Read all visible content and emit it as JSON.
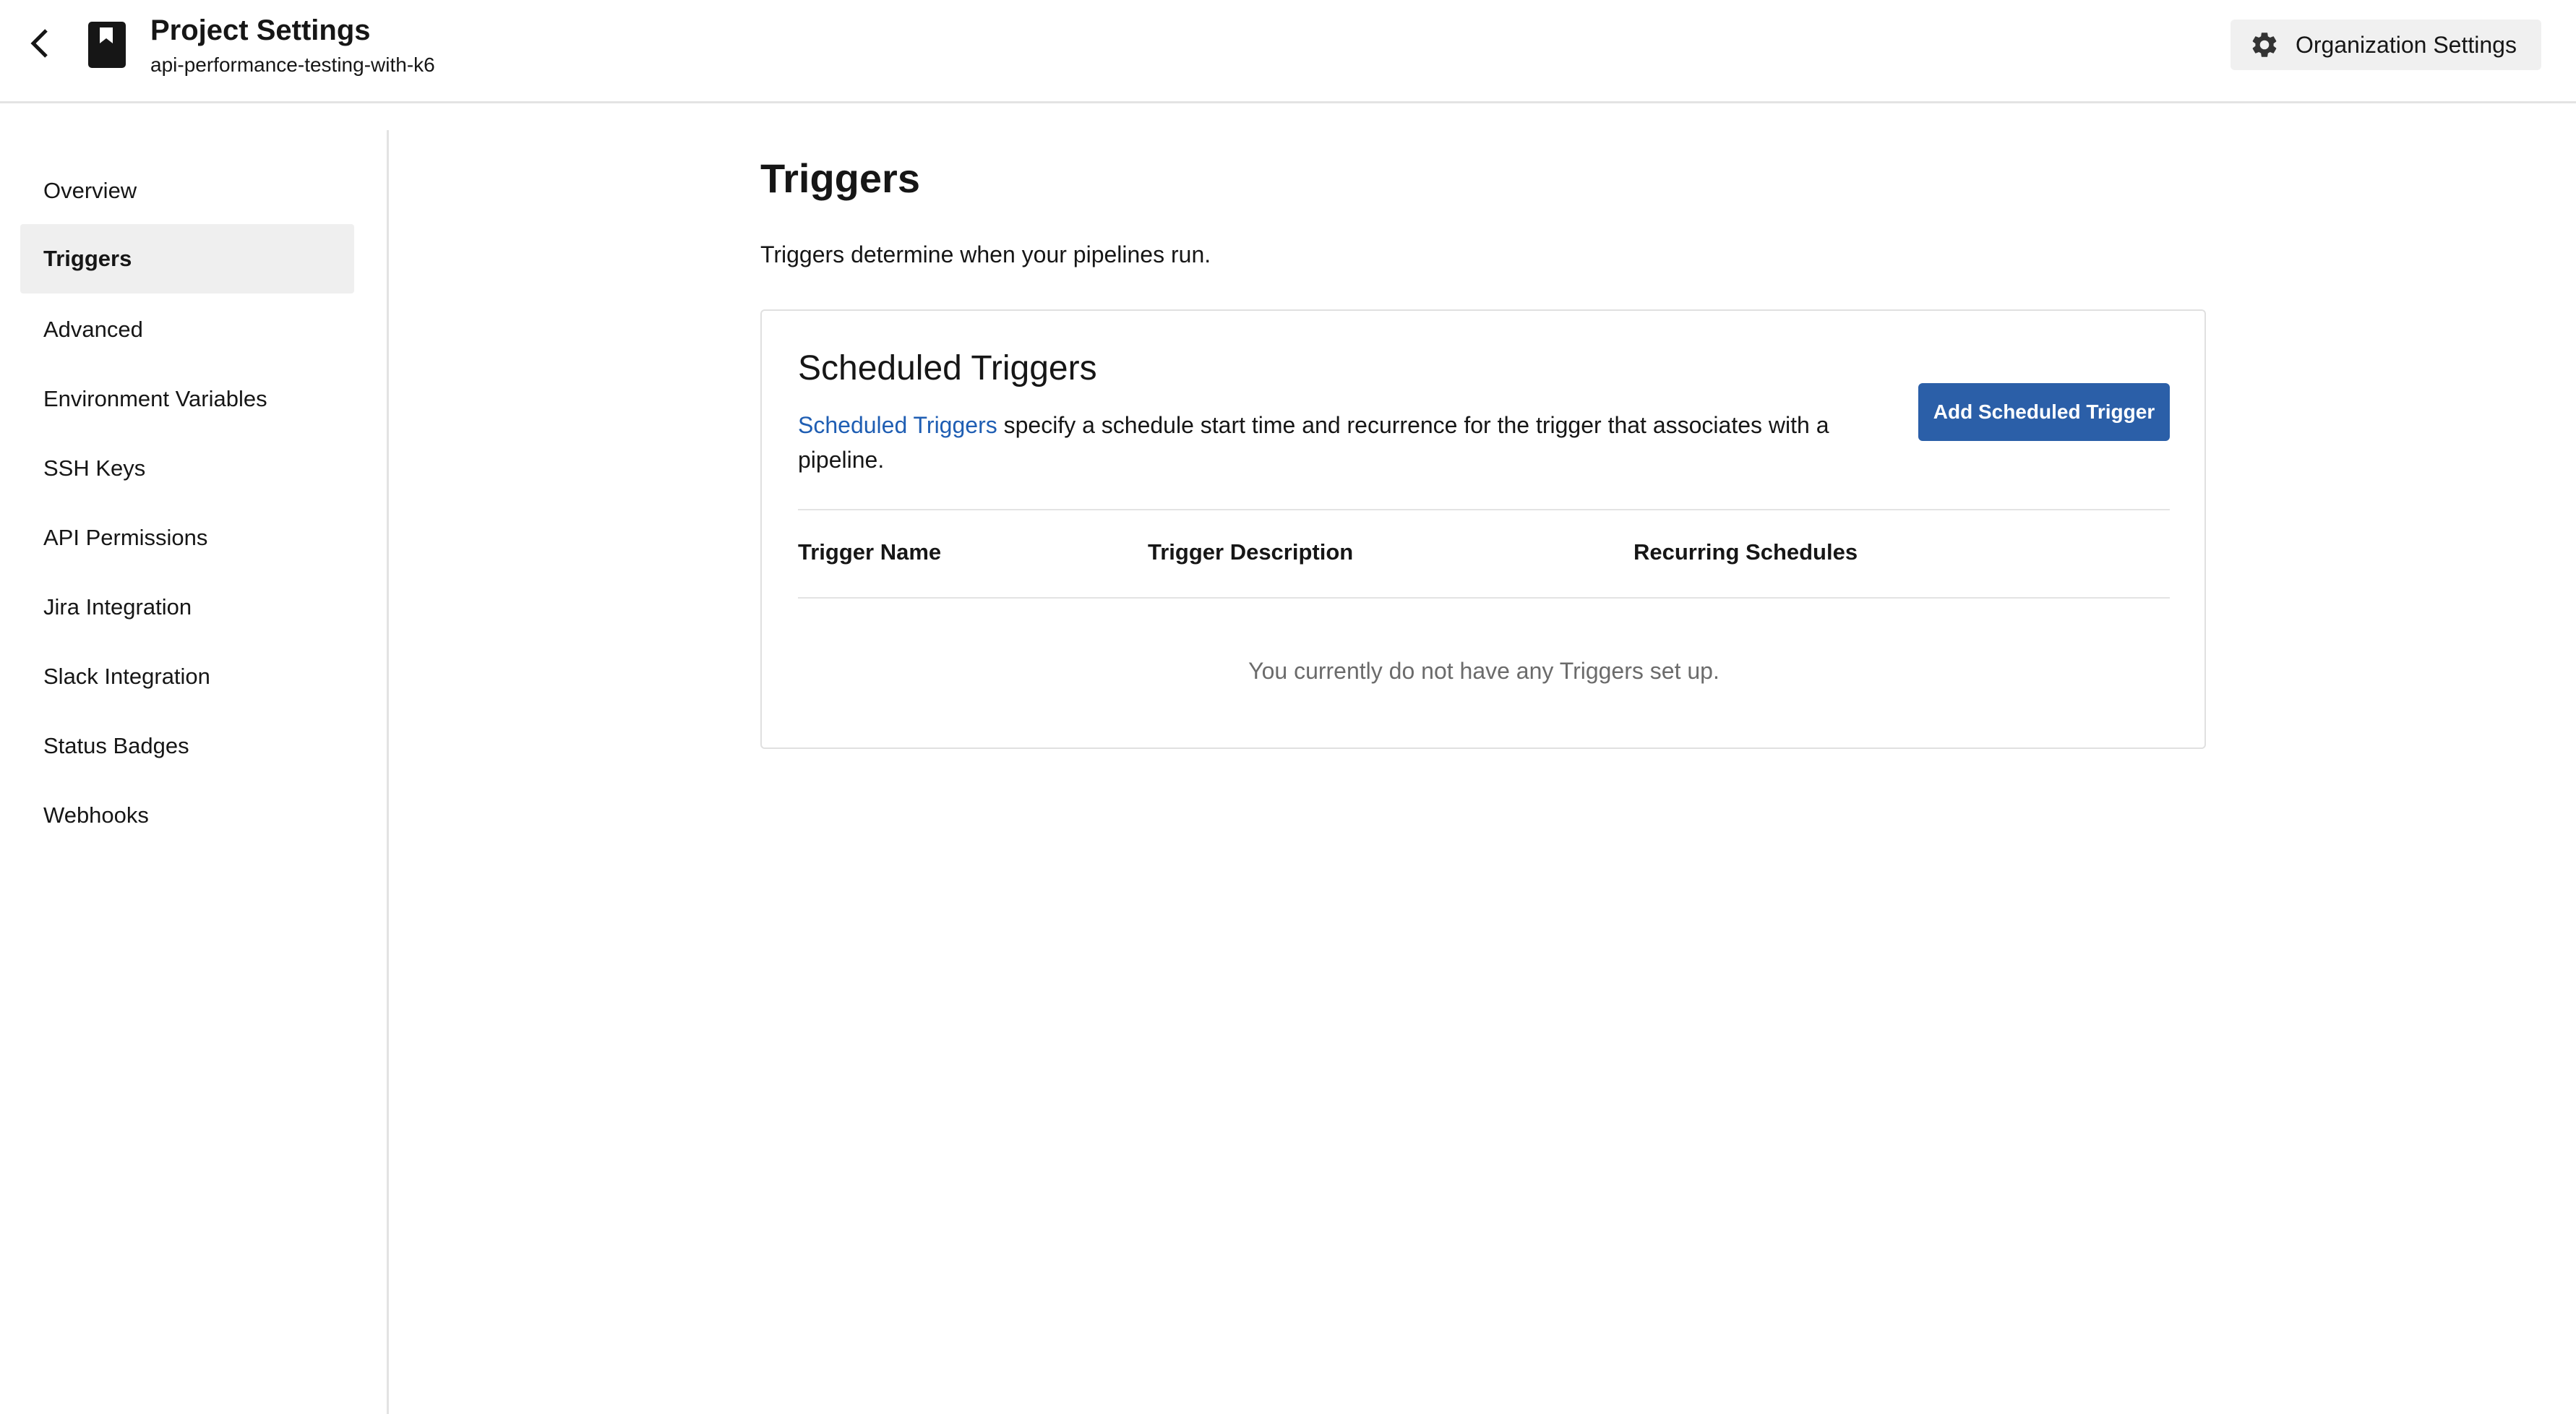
{
  "header": {
    "title": "Project Settings",
    "project_slug": "api-performance-testing-with-k6",
    "org_settings_label": "Organization Settings"
  },
  "sidebar": {
    "items": [
      {
        "label": "Overview",
        "active": false
      },
      {
        "label": "Triggers",
        "active": true
      },
      {
        "label": "Advanced",
        "active": false
      },
      {
        "label": "Environment Variables",
        "active": false
      },
      {
        "label": "SSH Keys",
        "active": false
      },
      {
        "label": "API Permissions",
        "active": false
      },
      {
        "label": "Jira Integration",
        "active": false
      },
      {
        "label": "Slack Integration",
        "active": false
      },
      {
        "label": "Status Badges",
        "active": false
      },
      {
        "label": "Webhooks",
        "active": false
      }
    ]
  },
  "main": {
    "title": "Triggers",
    "description": "Triggers determine when your pipelines run.",
    "card": {
      "title": "Scheduled Triggers",
      "link_text": "Scheduled Triggers",
      "description_rest": " specify a schedule start time and recurrence for the trigger that associates with a pipeline.",
      "add_button": "Add Scheduled Trigger",
      "columns": [
        "Trigger Name",
        "Trigger Description",
        "Recurring Schedules"
      ],
      "empty_message": "You currently do not have any Triggers set up."
    }
  },
  "colors": {
    "accent": "#2b5fa8",
    "link": "#1f5eb3",
    "active_bg": "#efefef"
  },
  "icons": {
    "back": "chevron-left-icon",
    "project": "bookmark-icon",
    "org": "gear-icon"
  }
}
